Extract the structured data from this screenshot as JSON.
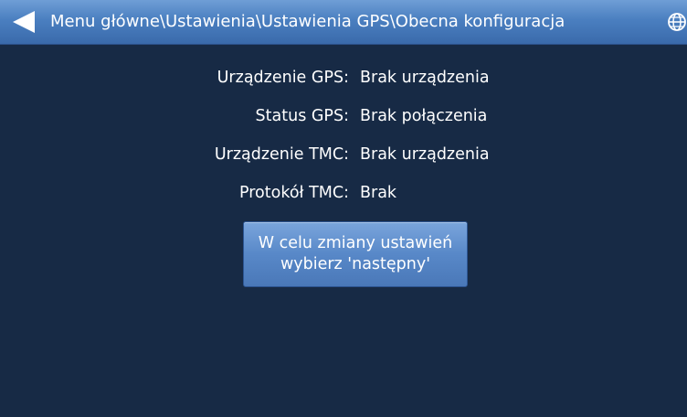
{
  "header": {
    "breadcrumb": "Menu główne\\Ustawienia\\Ustawienia GPS\\Obecna konfiguracja",
    "back_icon": "back-arrow-icon",
    "globe_icon": "globe-icon"
  },
  "config": [
    {
      "label": "Urządzenie GPS:",
      "value": "Brak urządzenia"
    },
    {
      "label": "Status GPS:",
      "value": "Brak połączenia"
    },
    {
      "label": "Urządzenie TMC:",
      "value": "Brak urządzenia"
    },
    {
      "label": "Protokół TMC:",
      "value": "Brak"
    }
  ],
  "next_button": {
    "line1": "W celu zmiany ustawień",
    "line2": "wybierz 'następny'"
  },
  "colors": {
    "background": "#172a45",
    "header": "#4a7fc0",
    "button": "#5888c8"
  }
}
